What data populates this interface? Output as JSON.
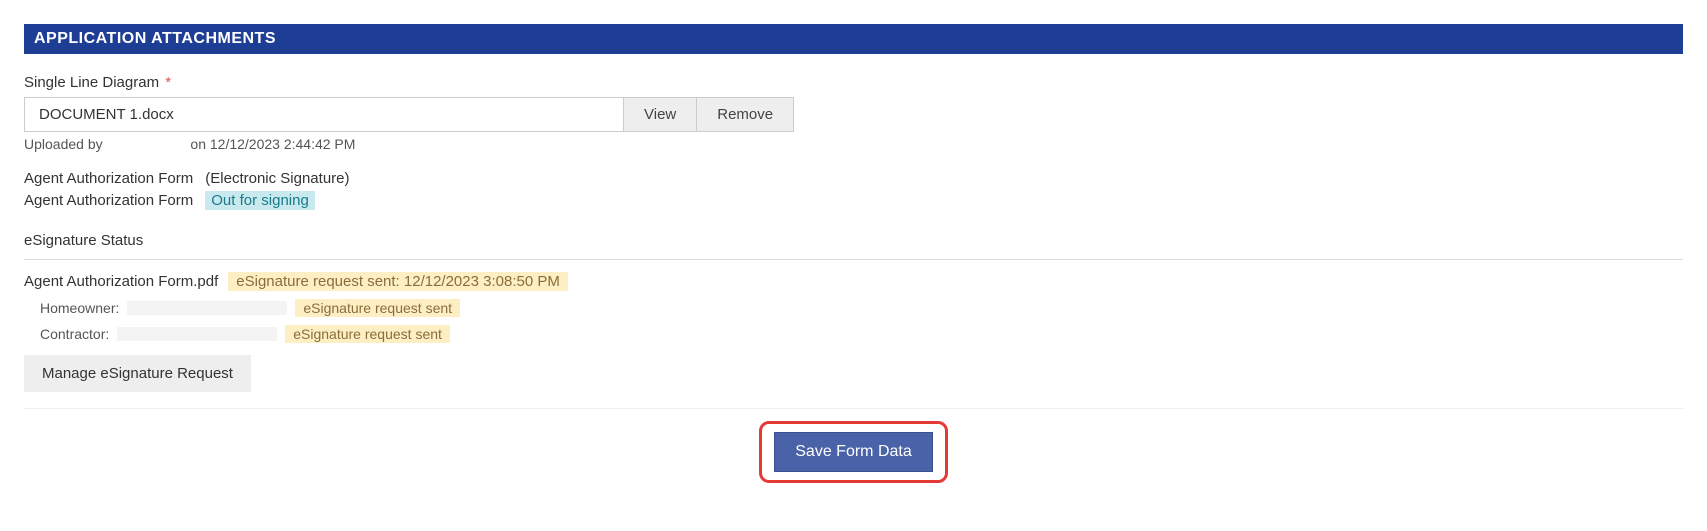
{
  "section": {
    "title": "APPLICATION ATTACHMENTS"
  },
  "sld": {
    "label": "Single Line Diagram",
    "required_mark": "*",
    "filename": "DOCUMENT 1.docx",
    "view_label": "View",
    "remove_label": "Remove",
    "uploaded_prefix": "Uploaded by",
    "uploaded_suffix": "on 12/12/2023 2:44:42 PM"
  },
  "auth": {
    "line1_label": "Agent Authorization Form",
    "line1_note": "(Electronic Signature)",
    "line2_label": "Agent Authorization Form",
    "line2_status": "Out for signing"
  },
  "esig": {
    "heading": "eSignature Status",
    "filename": "Agent Authorization Form.pdf",
    "file_status": "eSignature request sent: 12/12/2023 3:08:50 PM",
    "signers": {
      "homeowner_label": "Homeowner:",
      "homeowner_status": "eSignature request sent",
      "contractor_label": "Contractor:",
      "contractor_status": "eSignature request sent"
    },
    "manage_label": "Manage eSignature Request"
  },
  "actions": {
    "save_label": "Save Form Data"
  }
}
